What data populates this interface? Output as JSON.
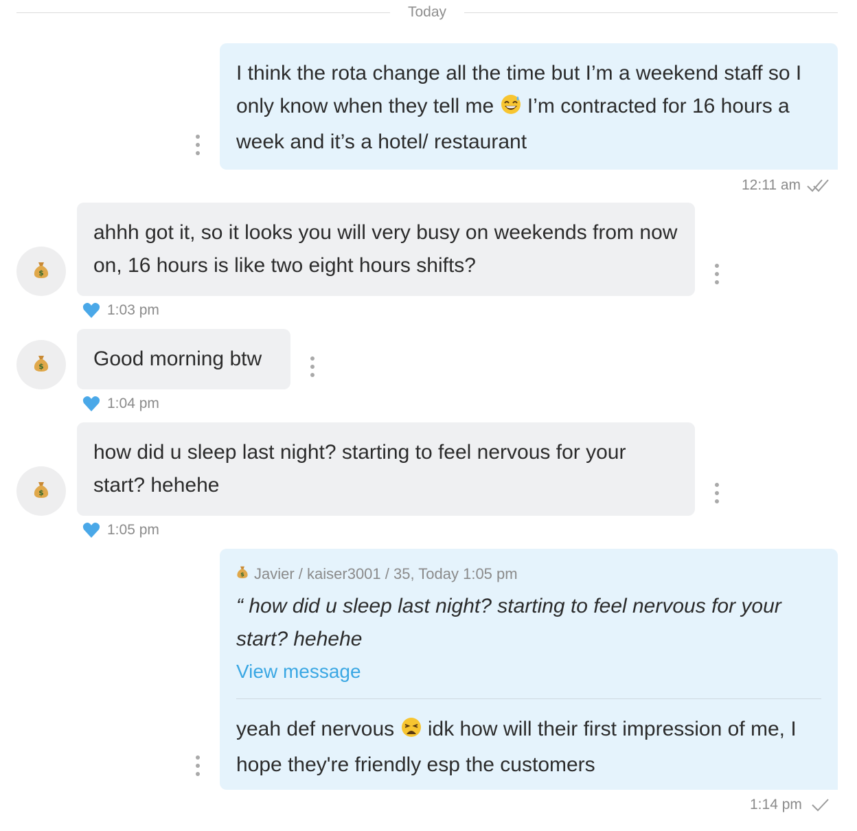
{
  "day_divider": "Today",
  "messages": [
    {
      "direction": "out",
      "text_a": "I think the rota change all the time but I’m a weekend staff so I only know when they tell me",
      "emoji_a": "grinning-sweat",
      "text_b": "I’m contracted for 16 hours a week and it’s a hotel/ restaurant",
      "time": "12:11 am",
      "status": "read-double-check"
    },
    {
      "direction": "in",
      "avatar": "money-bag-icon",
      "text": "ahhh got it, so it looks you will very busy on weekends from now on, 16 hours is like two eight hours shifts?",
      "reaction": "blue-heart",
      "time": "1:03 pm"
    },
    {
      "direction": "in",
      "avatar": "money-bag-icon",
      "text": "Good morning btw",
      "reaction": "blue-heart",
      "time": "1:04 pm"
    },
    {
      "direction": "in",
      "avatar": "money-bag-icon",
      "text": "how did u sleep last night? starting to feel nervous for your start? hehehe",
      "reaction": "blue-heart",
      "time": "1:05 pm"
    },
    {
      "direction": "out",
      "quote": {
        "author": "Javier / kaiser3001 / 35, Today 1:05 pm",
        "text": "“ how did u sleep last night? starting to feel nervous for your start? hehehe",
        "link": "View message"
      },
      "text_a": "yeah def nervous",
      "emoji_a": "weary-face",
      "text_b": "idk how will their first impression of me, I hope they're friendly esp the customers",
      "time": "1:14 pm",
      "status": "sent-single-check"
    }
  ],
  "colors": {
    "outgoing_bubble": "#e5f3fc",
    "incoming_bubble": "#eff0f2",
    "link": "#3aa7e3",
    "heart": "#4aa8e8"
  }
}
